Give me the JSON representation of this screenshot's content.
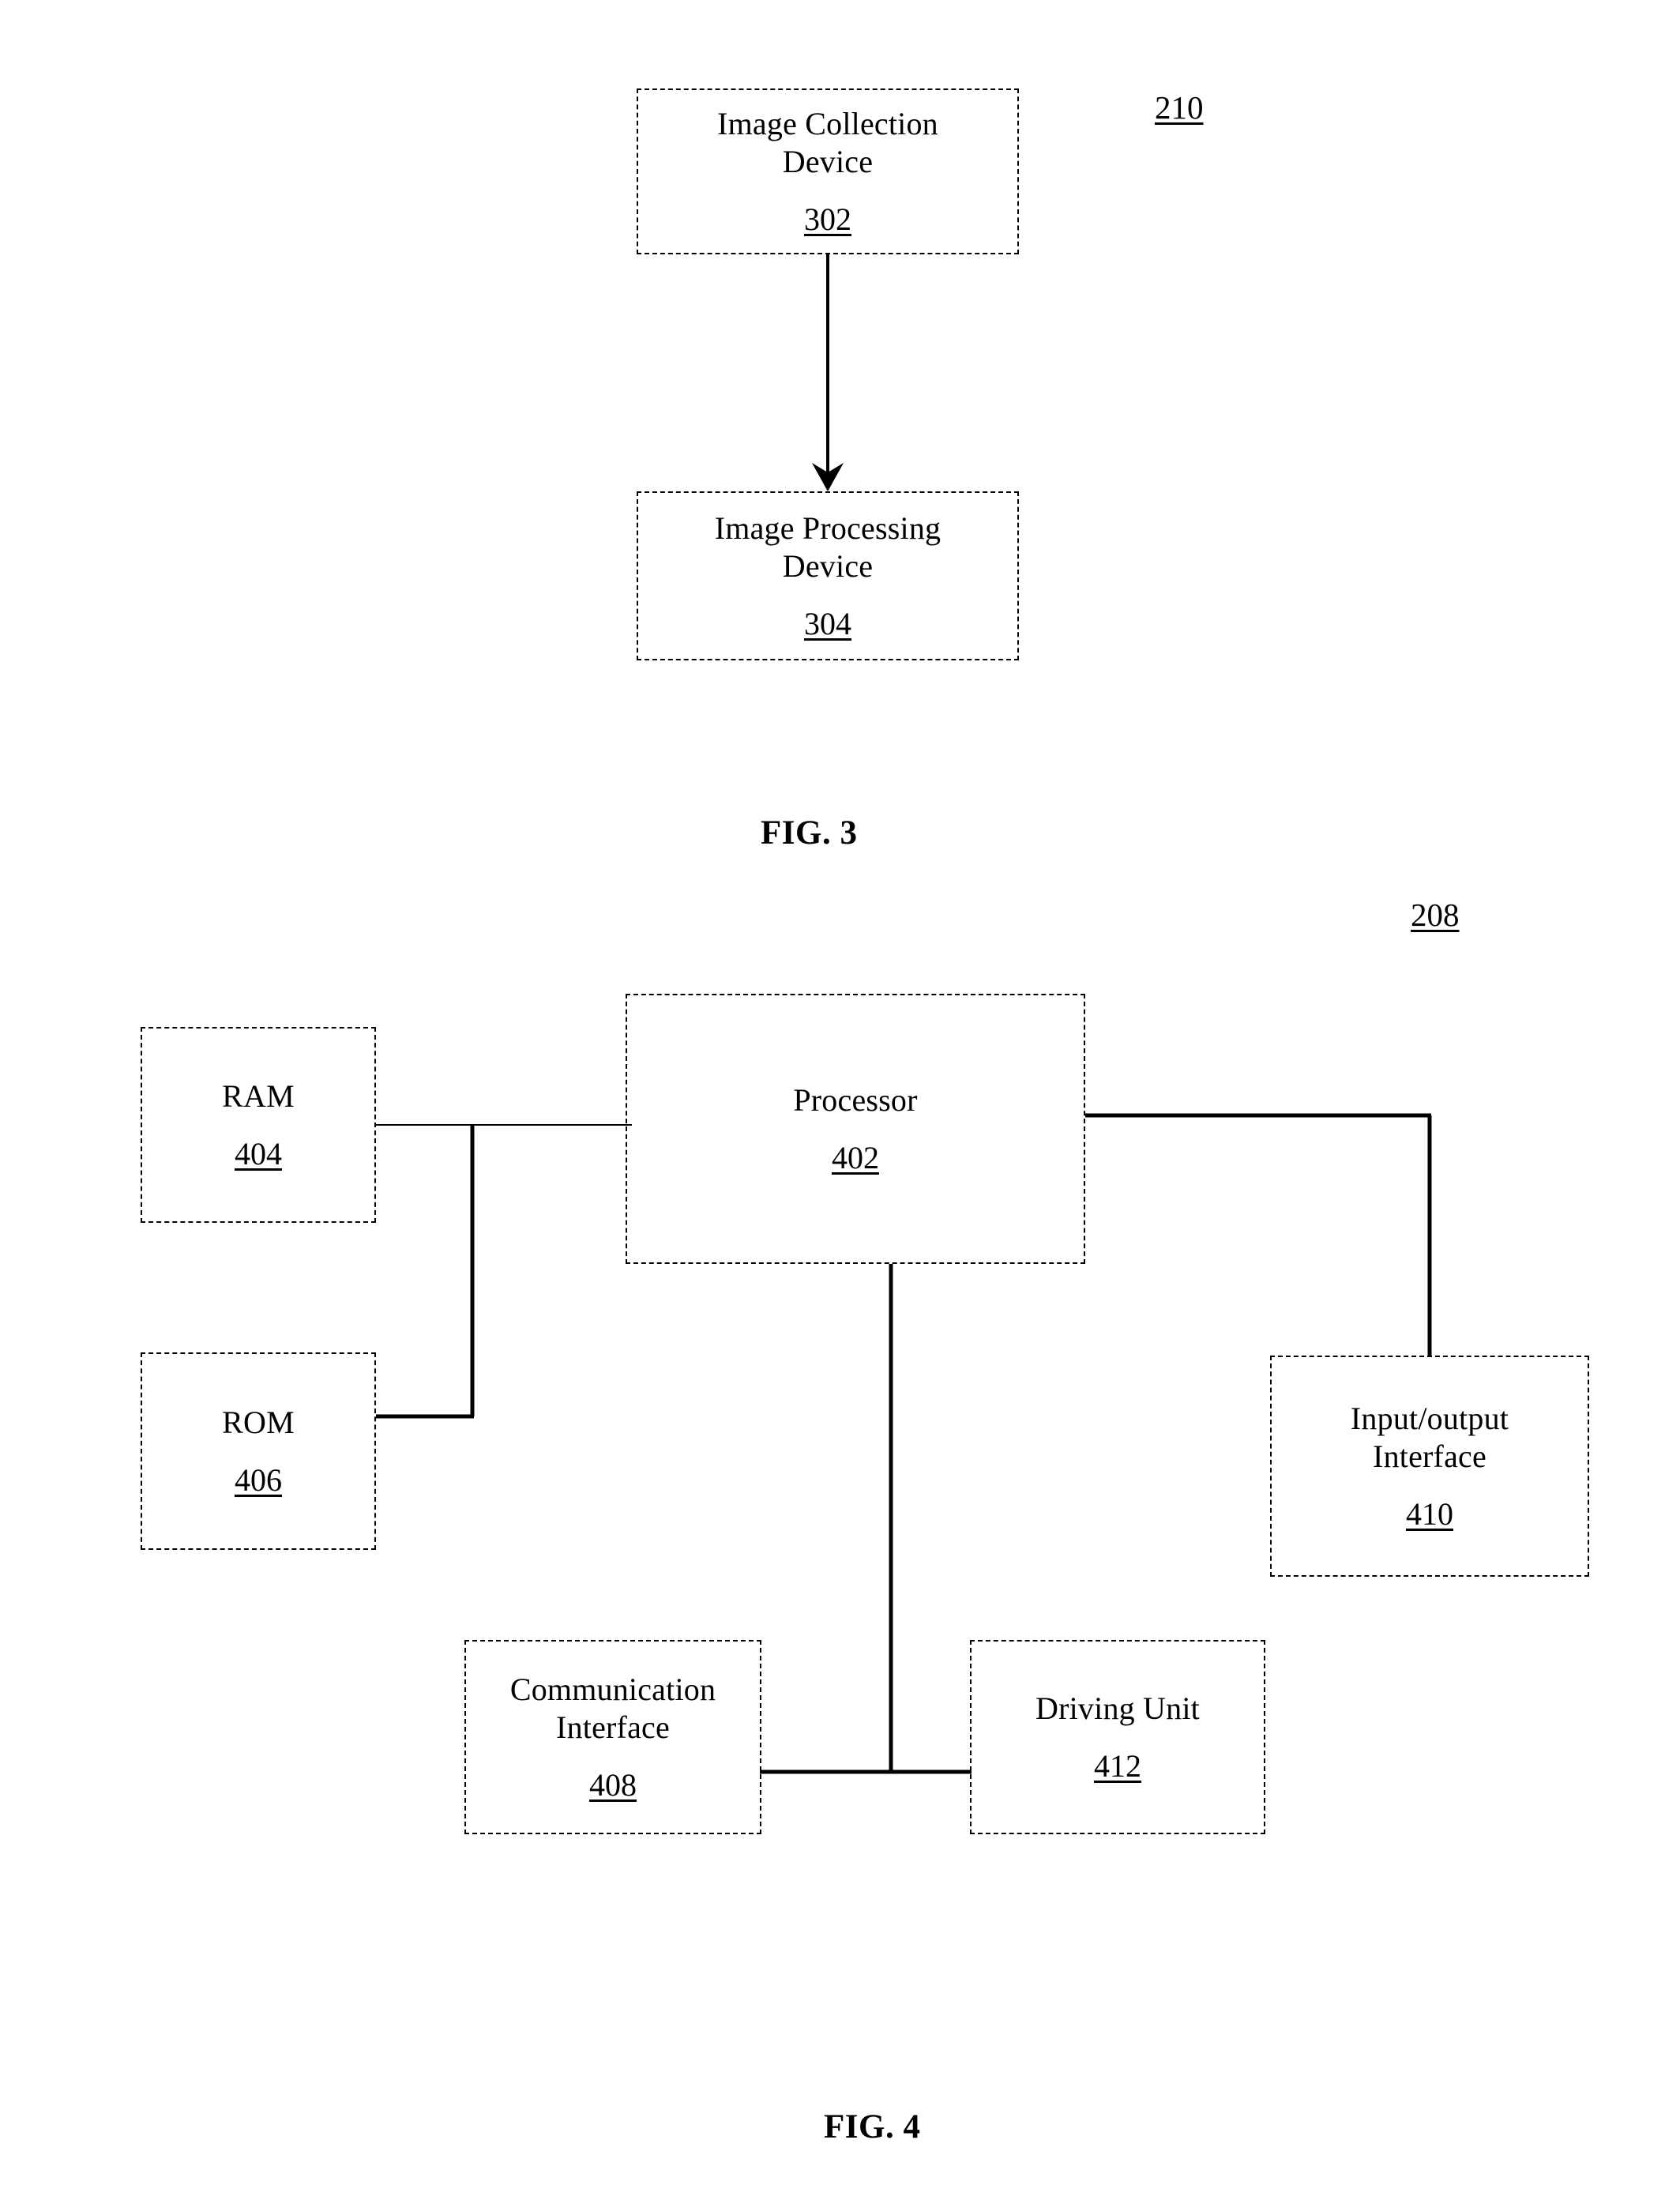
{
  "document": {
    "type": "patent-drawing-sheet",
    "figures": [
      {
        "id": "fig3",
        "caption": "FIG. 3",
        "system_ref": "210",
        "nodes": [
          {
            "id": "image-collection-device",
            "label": "Image Collection\nDevice",
            "ref": "302"
          },
          {
            "id": "image-processing-device",
            "label": "Image Processing\nDevice",
            "ref": "304"
          }
        ],
        "connections": [
          {
            "from": "image-collection-device",
            "to": "image-processing-device",
            "arrow": "single"
          }
        ]
      },
      {
        "id": "fig4",
        "caption": "FIG. 4",
        "system_ref": "208",
        "nodes": [
          {
            "id": "processor",
            "label": "Processor",
            "ref": "402"
          },
          {
            "id": "ram",
            "label": "RAM",
            "ref": "404"
          },
          {
            "id": "rom",
            "label": "ROM",
            "ref": "406"
          },
          {
            "id": "communication-interface",
            "label": "Communication\nInterface",
            "ref": "408"
          },
          {
            "id": "input-output-interface",
            "label": "Input/output\nInterface",
            "ref": "410"
          },
          {
            "id": "driving-unit",
            "label": "Driving Unit",
            "ref": "412"
          }
        ],
        "connections": [
          {
            "from": "ram",
            "to": "processor",
            "arrow": "none"
          },
          {
            "from": "rom",
            "to": "processor",
            "arrow": "none"
          },
          {
            "from": "processor",
            "to": "input-output-interface",
            "arrow": "none"
          },
          {
            "from": "processor",
            "to": "driving-unit",
            "arrow": "none"
          },
          {
            "from": "processor",
            "to": "communication-interface",
            "arrow": "none"
          }
        ]
      }
    ]
  },
  "colors": {
    "ink": "#000000",
    "paper": "#ffffff"
  }
}
